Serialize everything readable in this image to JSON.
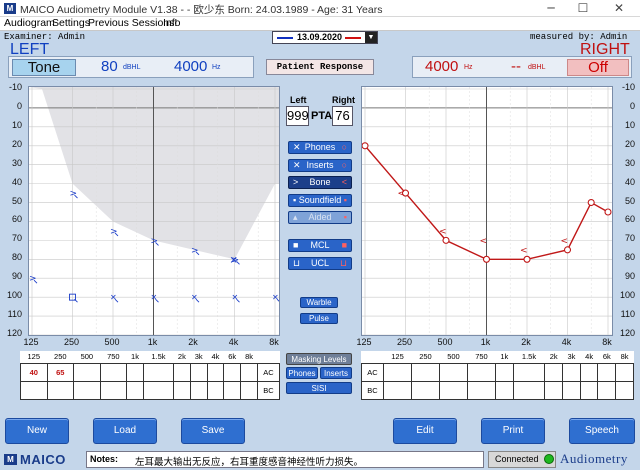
{
  "window": {
    "title": "MAICO Audiometry Module V1.38 -  - 欧少东   Born: 24.03.1989 - Age: 31 Years",
    "controls": [
      "─",
      "☐",
      "✕"
    ]
  },
  "menu": [
    "Audiogram",
    "Settings",
    "Previous Sessions!",
    "Info"
  ],
  "examiner": "Examiner: Admin",
  "measured_by": "measured by: Admin",
  "date": "13.09.2020",
  "left": {
    "title": "LEFT",
    "mode": "Tone",
    "level": "80",
    "level_unit": "dBHL",
    "freq": "4000",
    "freq_unit": "Hz"
  },
  "right": {
    "title": "RIGHT",
    "freq": "4000",
    "freq_unit": "Hz",
    "level": "--",
    "level_unit": "dBHL",
    "mode": "Off"
  },
  "patient_response": "Patient Response",
  "pta": {
    "left_label": "Left",
    "right_label": "Right",
    "left_value": "999",
    "right_value": "76",
    "label": "PTA"
  },
  "side_buttons": {
    "phones": "Phones",
    "inserts": "Inserts",
    "bone": "Bone",
    "soundfield": "Soundfield",
    "aided": "Aided",
    "mcl": "MCL",
    "ucl": "UCL",
    "warble": "Warble",
    "pulse": "Pulse"
  },
  "y_ticks": [
    "-10",
    "0",
    "10",
    "20",
    "30",
    "40",
    "50",
    "60",
    "70",
    "80",
    "90",
    "100",
    "110",
    "120"
  ],
  "x_ticks": [
    "125",
    "250",
    "500",
    "1k",
    "2k",
    "4k",
    "8k"
  ],
  "masking": {
    "title": "Masking Levels",
    "phones": "Phones",
    "inserts": "Inserts",
    "sisi": "SISI",
    "freqs": [
      "125",
      "250",
      "500",
      "750",
      "1k",
      "1.5k",
      "2k",
      "3k",
      "4k",
      "6k",
      "8k"
    ],
    "left_ac": [
      "40",
      "65",
      "",
      "",
      "",
      "",
      "",
      "",
      "",
      "",
      ""
    ],
    "row_ac": "AC",
    "row_bc": "BC"
  },
  "buttons": {
    "new": "New",
    "load": "Load",
    "save": "Save",
    "edit": "Edit",
    "print": "Print",
    "speech": "Speech"
  },
  "status": {
    "brand": "MAICO",
    "notes_label": "Notes:",
    "notes": "左耳最大输出无反应，右耳重度感音神经性听力损失。",
    "connected": "Connected",
    "app": "Audiometry"
  },
  "chart_data": [
    {
      "type": "scatter",
      "title": "LEFT",
      "x_scale": "log",
      "categories": [
        "125",
        "250",
        "500",
        "1k",
        "2k",
        "4k",
        "8k"
      ],
      "ylim": [
        -10,
        120
      ],
      "y_inverted": true,
      "series": [
        {
          "values": [
            {
              "x": "125",
              "y": 90
            },
            {
              "x": "250",
              "y": 45
            },
            {
              "x": "500",
              "y": 65
            },
            {
              "x": "1k",
              "y": 70
            },
            {
              "x": "2k",
              "y": 75
            },
            {
              "x": "4k",
              "y": 80
            }
          ]
        },
        {
          "values": [
            {
              "x": "250",
              "y": 100
            },
            {
              "x": "500",
              "y": 100
            },
            {
              "x": "1k",
              "y": 100
            },
            {
              "x": "2k",
              "y": 100
            },
            {
              "x": "4k",
              "y": 100
            },
            {
              "x": "8k",
              "y": 100
            }
          ]
        }
      ]
    },
    {
      "type": "line",
      "title": "RIGHT",
      "x_scale": "log",
      "categories": [
        "125",
        "250",
        "500",
        "1k",
        "2k",
        "4k",
        "6k",
        "8k"
      ],
      "ylim": [
        -10,
        120
      ],
      "y_inverted": true,
      "series": [
        {
          "values": [
            {
              "x": "125",
              "y": 20
            },
            {
              "x": "250",
              "y": 45
            },
            {
              "x": "500",
              "y": 70
            },
            {
              "x": "1k",
              "y": 80
            },
            {
              "x": "2k",
              "y": 80
            },
            {
              "x": "4k",
              "y": 75
            },
            {
              "x": "6k",
              "y": 50
            },
            {
              "x": "8k",
              "y": 55
            }
          ]
        },
        {
          "values": [
            {
              "x": "500",
              "y": 65
            },
            {
              "x": "1k",
              "y": 70
            },
            {
              "x": "2k",
              "y": 75
            },
            {
              "x": "4k",
              "y": 70
            }
          ]
        }
      ]
    }
  ]
}
